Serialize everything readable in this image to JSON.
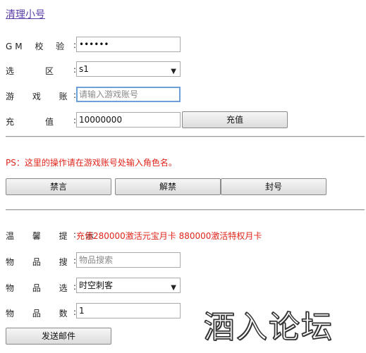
{
  "title_link": "清理小号",
  "gm_code": {
    "label": "GM 校 验 码",
    "value": "••••••"
  },
  "zone": {
    "label": "选      区",
    "value": "s1"
  },
  "account": {
    "label": "游 戏 账 号",
    "placeholder": "请输入游戏账号"
  },
  "recharge": {
    "label": "充      值",
    "value": "10000000",
    "button": "充值"
  },
  "ps_note": "PS：这里的操作请在游戏账号处输入角色名。",
  "actions": {
    "mute": "禁言",
    "unmute": "解禁",
    "ban": "封号"
  },
  "tip": {
    "label": "温 馨 提 示",
    "text": "充值280000激活元宝月卡 880000激活特权月卡"
  },
  "item_search": {
    "label": "物 品 搜 索",
    "placeholder": "物品搜索"
  },
  "item_select": {
    "label": "物 品 选 择",
    "value": "时空刺客"
  },
  "item_qty": {
    "label": "物 品 数 量",
    "value": "1"
  },
  "send_mail": "发送邮件",
  "colon": ":",
  "watermark": "酒入论坛"
}
